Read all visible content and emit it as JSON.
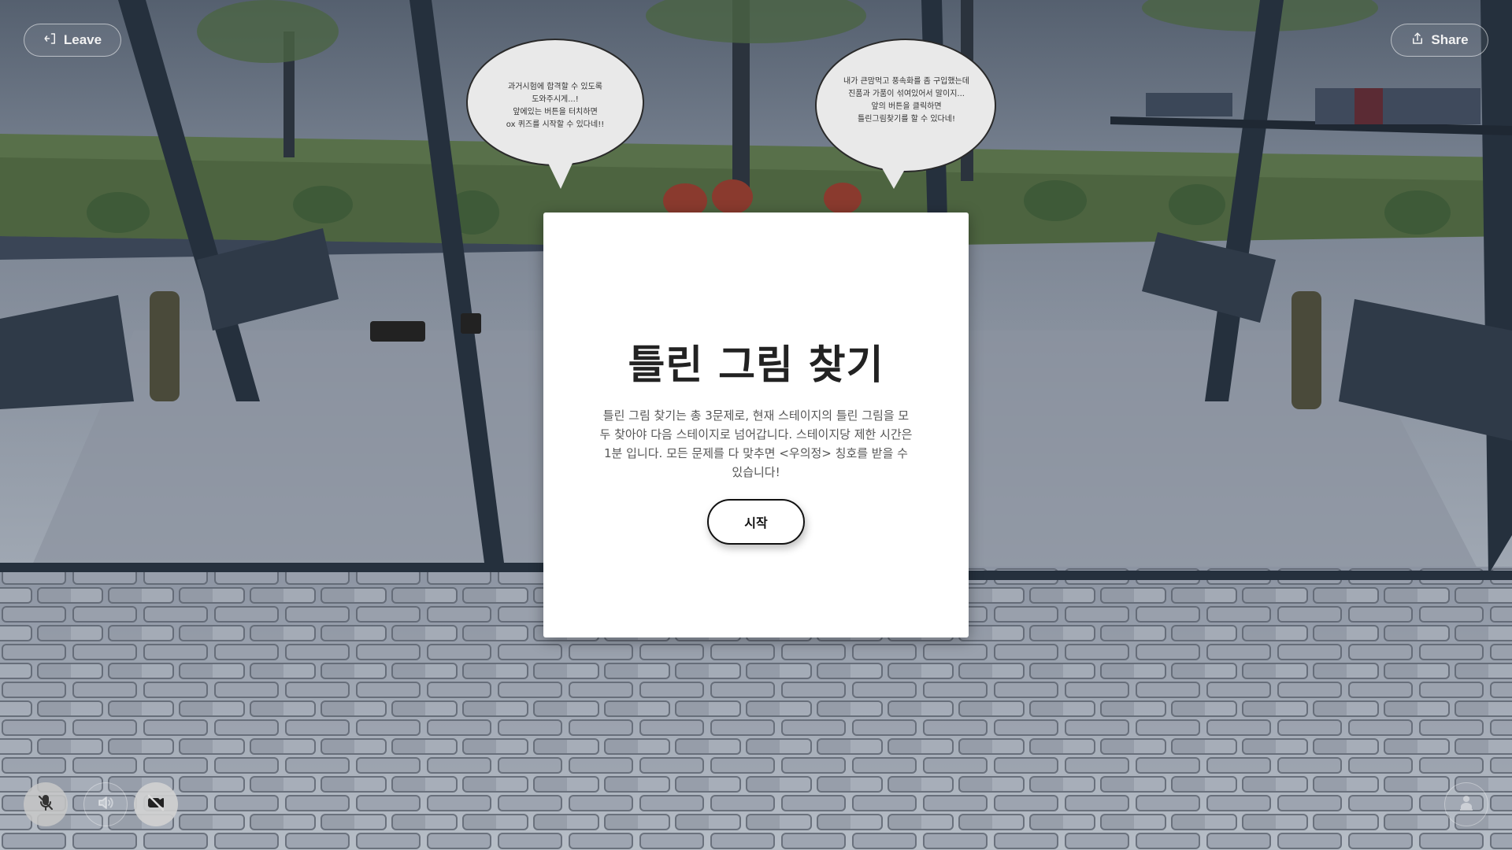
{
  "header": {
    "leave_label": "Leave",
    "share_label": "Share"
  },
  "scene": {
    "bubble_left_text": "과거시험에 합격할 수 있도록\n도와주시게...!\n앞에있는 버튼을 터치하면\nox 퀴즈를 시작할 수 있다네!!",
    "bubble_right_text": "내가 큰맘먹고 풍속화를 좀 구입했는데\n진품과 가품이 섞여있어서 말이지...\n앞의 버튼을 클릭하면\n틀린그림찾기를 할 수 있다네!"
  },
  "modal": {
    "title": "틀린 그림 찾기",
    "description": "틀린 그림 찾기는 총 3문제로, 현재 스테이지의 틀린 그림을 모두 찾아야 다음 스테이지로 넘어갑니다. 스테이지당 제한 시간은 1분 입니다. 모든 문제를 다 맞추면 <우의정> 칭호를 받을 수 있습니다!",
    "start_label": "시작"
  },
  "controls": {
    "mic_icon": "mic-off-icon",
    "speaker_icon": "speaker-icon",
    "camera_icon": "camera-off-icon",
    "avatar_icon": "avatar-icon"
  }
}
